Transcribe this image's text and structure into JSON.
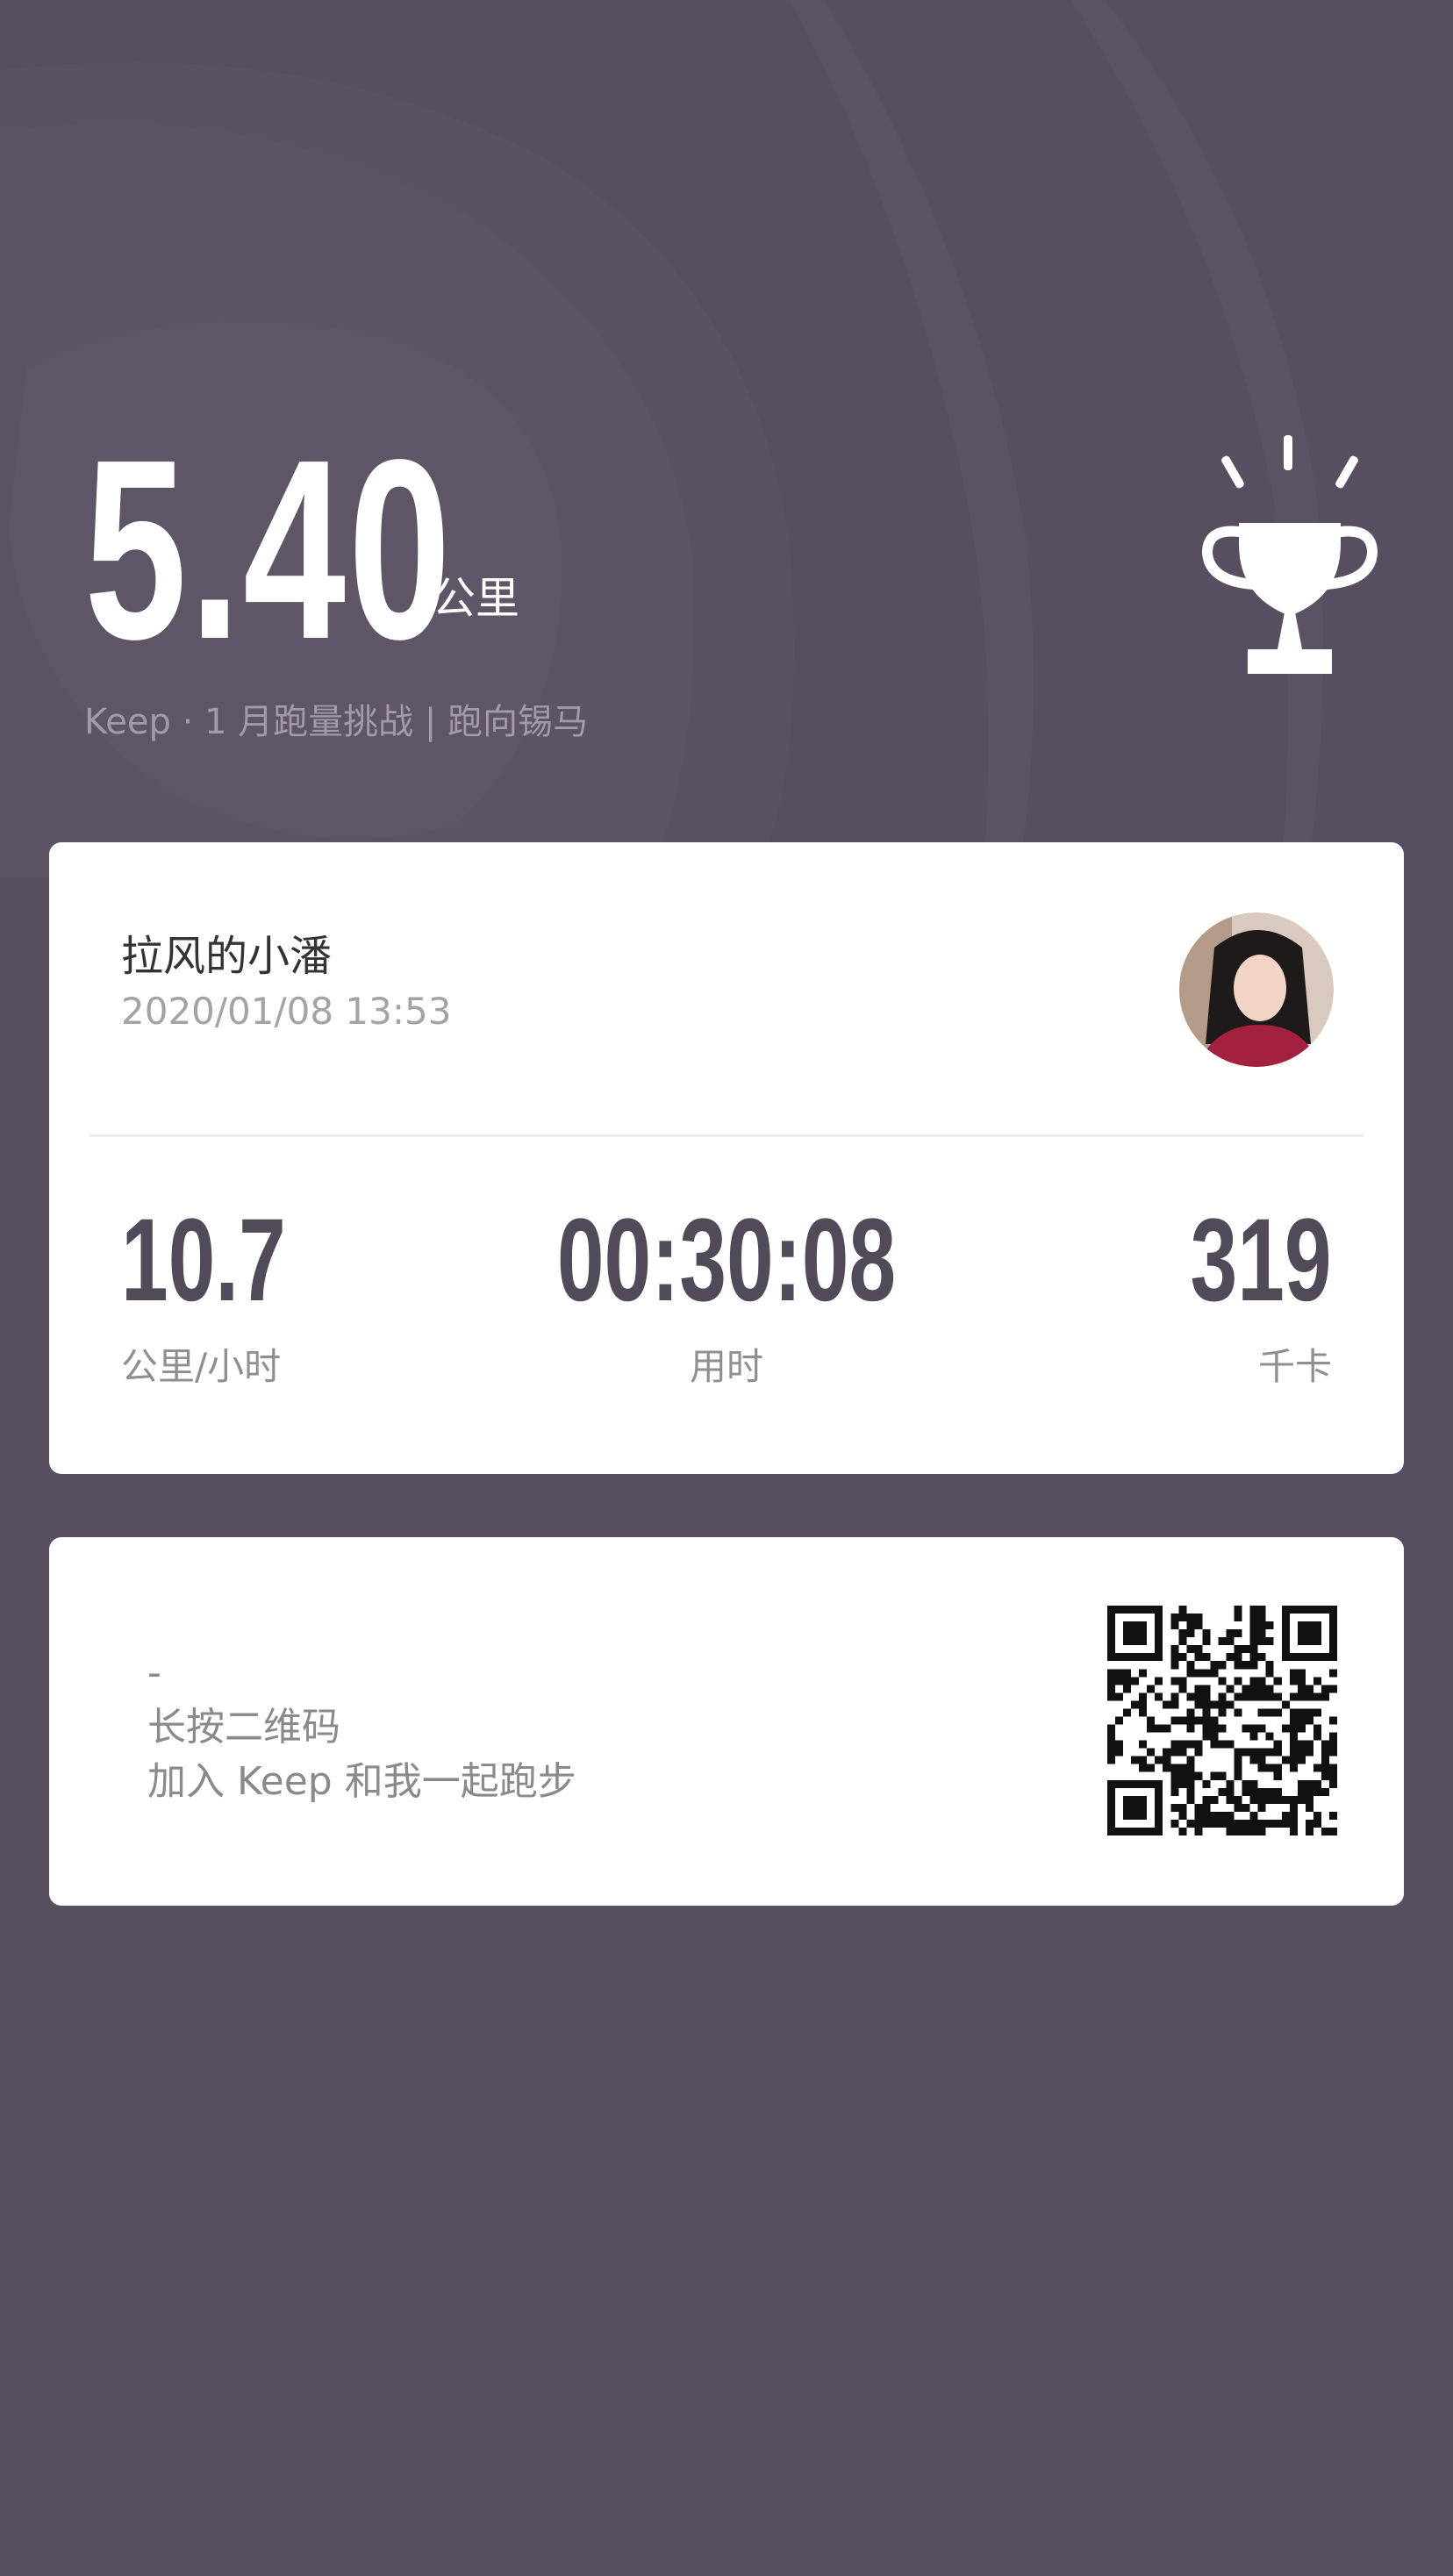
{
  "hero": {
    "distance": "5.40",
    "distance_unit": "公里",
    "challenge": "Keep · 1 月跑量挑战 | 跑向锡马"
  },
  "user_card": {
    "username": "拉风的小潘",
    "datetime": "2020/01/08 13:53",
    "stats": [
      {
        "value": "10.7",
        "label": "公里/小时"
      },
      {
        "value": "00:30:08",
        "label": "用时"
      },
      {
        "value": "319",
        "label": "千卡"
      }
    ]
  },
  "qr_card": {
    "dash": "-",
    "line1": "长按二维码",
    "line2": "加入 Keep 和我一起跑步"
  },
  "icons": {
    "trophy": "trophy-icon",
    "avatar": "avatar",
    "qr": "qr-code"
  },
  "colors": {
    "background": "#574f5f",
    "stat_text": "#504a59",
    "card": "#ffffff"
  }
}
